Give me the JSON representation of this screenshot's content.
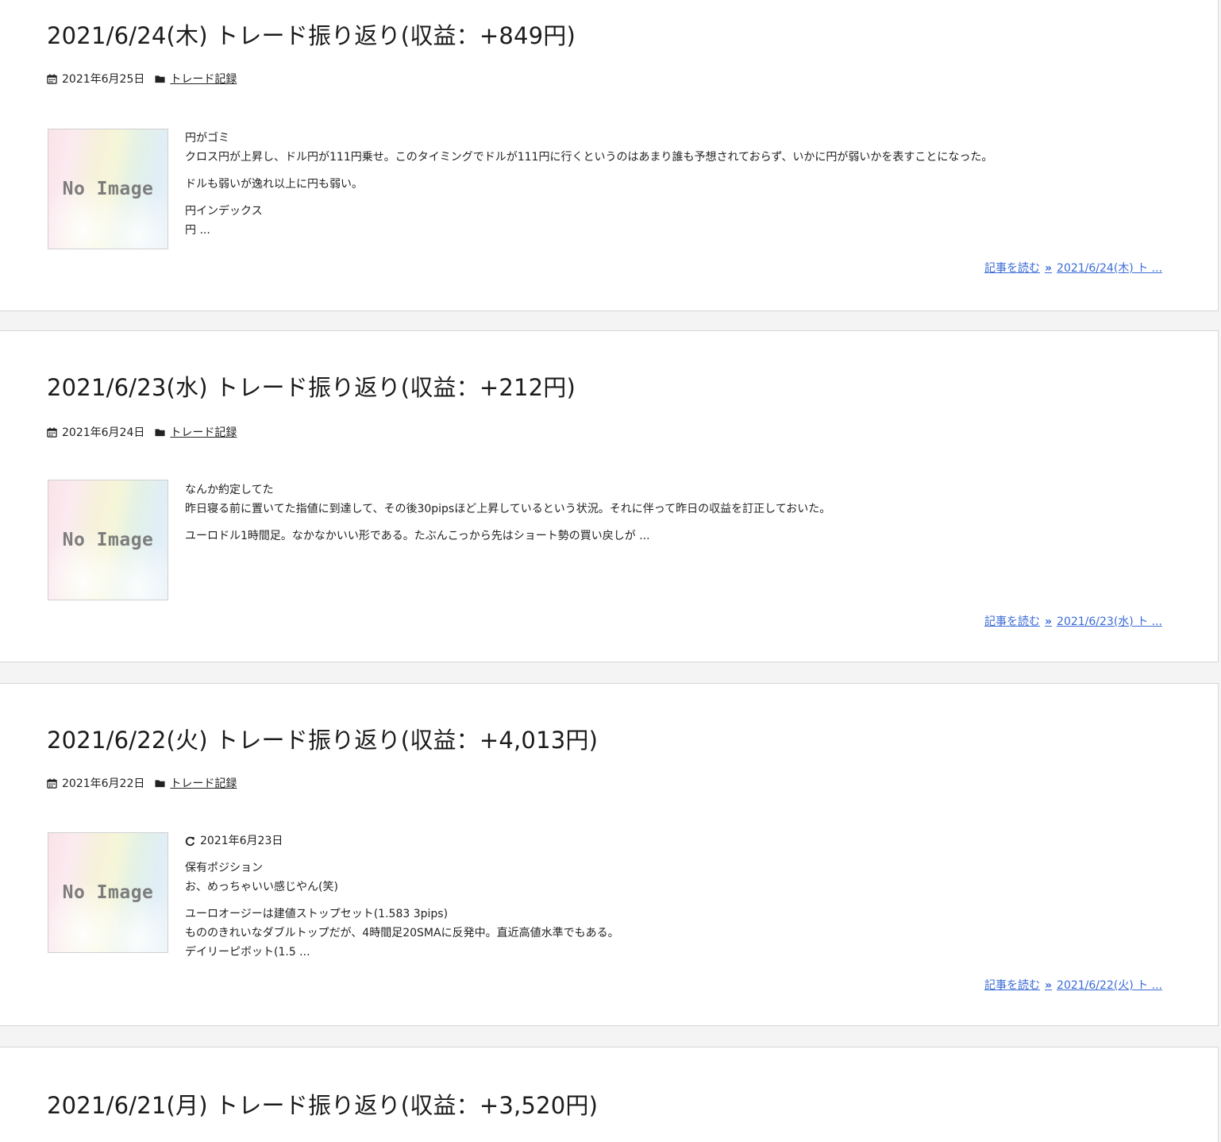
{
  "posts": [
    {
      "title": "2021/6/24(木) トレード振り返り(収益：+849円)",
      "date": "2021年6月25日",
      "category": "トレード記録",
      "thumbnail_text": "No Image",
      "excerpt_lines": [
        "円がゴミ",
        "クロス円が上昇し、ドル円が111円乗せ。このタイミングでドルが111円に行くというのはあまり誰も予想されておらず、いかに円が弱いかを表すことになった。",
        "ドルも弱いが逸れ以上に円も弱い。",
        "円インデックス",
        "円 ..."
      ],
      "readmore_label": "記事を読む",
      "readmore_title": "2021/6/24(木) ト ..."
    },
    {
      "title": "2021/6/23(水) トレード振り返り(収益：+212円)",
      "date": "2021年6月24日",
      "category": "トレード記録",
      "thumbnail_text": "No Image",
      "excerpt_lines": [
        "なんか約定してた",
        "昨日寝る前に置いてた指値に到達して、その後30pipsほど上昇しているという状況。それに伴って昨日の収益を訂正しておいた。",
        "ユーロドル1時間足。なかなかいい形である。たぶんこっから先はショート勢の買い戻しが ..."
      ],
      "readmore_label": "記事を読む",
      "readmore_title": "2021/6/23(水) ト ..."
    },
    {
      "title": "2021/6/22(火) トレード振り返り(収益：+4,013円)",
      "date": "2021年6月22日",
      "category": "トレード記録",
      "thumbnail_text": "No Image",
      "updated_date": "2021年6月23日",
      "excerpt_lines": [
        "保有ポジション",
        "お、めっちゃいい感じやん(笑)",
        "ユーロオージーは建値ストップセット(1.583 3pips)",
        "もののきれいなダブルトップだが、4時間足20SMAに反発中。直近高値水準でもある。",
        "デイリーピボット(1.5 ..."
      ],
      "readmore_label": "記事を読む",
      "readmore_title": "2021/6/22(火) ト ..."
    },
    {
      "title": "2021/6/21(月) トレード振り返り(収益：+3,520円)"
    }
  ]
}
